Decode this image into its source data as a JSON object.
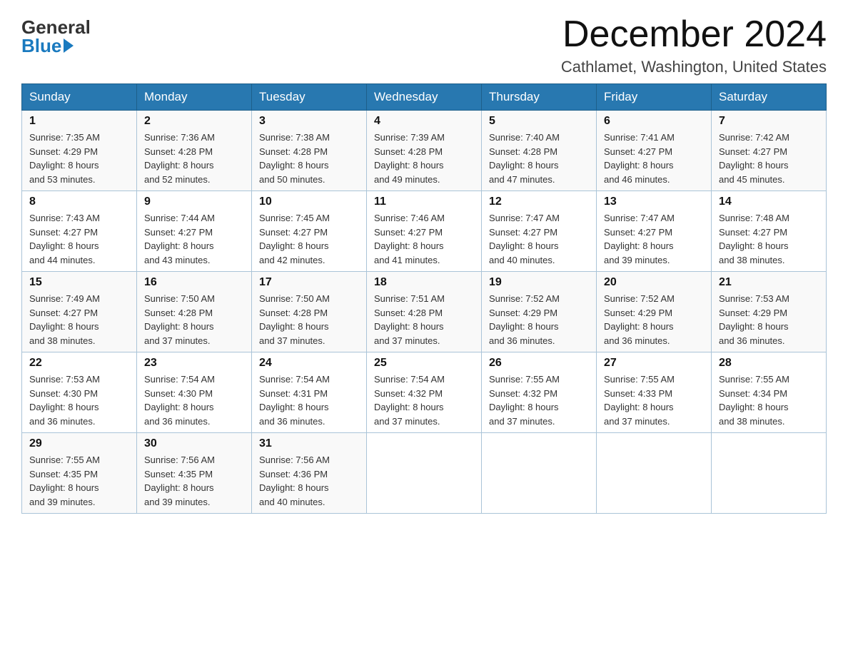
{
  "header": {
    "logo_general": "General",
    "logo_blue": "Blue",
    "month_title": "December 2024",
    "location": "Cathlamet, Washington, United States"
  },
  "days_of_week": [
    "Sunday",
    "Monday",
    "Tuesday",
    "Wednesday",
    "Thursday",
    "Friday",
    "Saturday"
  ],
  "weeks": [
    [
      {
        "day": "1",
        "sunrise": "7:35 AM",
        "sunset": "4:29 PM",
        "daylight": "8 hours and 53 minutes."
      },
      {
        "day": "2",
        "sunrise": "7:36 AM",
        "sunset": "4:28 PM",
        "daylight": "8 hours and 52 minutes."
      },
      {
        "day": "3",
        "sunrise": "7:38 AM",
        "sunset": "4:28 PM",
        "daylight": "8 hours and 50 minutes."
      },
      {
        "day": "4",
        "sunrise": "7:39 AM",
        "sunset": "4:28 PM",
        "daylight": "8 hours and 49 minutes."
      },
      {
        "day": "5",
        "sunrise": "7:40 AM",
        "sunset": "4:28 PM",
        "daylight": "8 hours and 47 minutes."
      },
      {
        "day": "6",
        "sunrise": "7:41 AM",
        "sunset": "4:27 PM",
        "daylight": "8 hours and 46 minutes."
      },
      {
        "day": "7",
        "sunrise": "7:42 AM",
        "sunset": "4:27 PM",
        "daylight": "8 hours and 45 minutes."
      }
    ],
    [
      {
        "day": "8",
        "sunrise": "7:43 AM",
        "sunset": "4:27 PM",
        "daylight": "8 hours and 44 minutes."
      },
      {
        "day": "9",
        "sunrise": "7:44 AM",
        "sunset": "4:27 PM",
        "daylight": "8 hours and 43 minutes."
      },
      {
        "day": "10",
        "sunrise": "7:45 AM",
        "sunset": "4:27 PM",
        "daylight": "8 hours and 42 minutes."
      },
      {
        "day": "11",
        "sunrise": "7:46 AM",
        "sunset": "4:27 PM",
        "daylight": "8 hours and 41 minutes."
      },
      {
        "day": "12",
        "sunrise": "7:47 AM",
        "sunset": "4:27 PM",
        "daylight": "8 hours and 40 minutes."
      },
      {
        "day": "13",
        "sunrise": "7:47 AM",
        "sunset": "4:27 PM",
        "daylight": "8 hours and 39 minutes."
      },
      {
        "day": "14",
        "sunrise": "7:48 AM",
        "sunset": "4:27 PM",
        "daylight": "8 hours and 38 minutes."
      }
    ],
    [
      {
        "day": "15",
        "sunrise": "7:49 AM",
        "sunset": "4:27 PM",
        "daylight": "8 hours and 38 minutes."
      },
      {
        "day": "16",
        "sunrise": "7:50 AM",
        "sunset": "4:28 PM",
        "daylight": "8 hours and 37 minutes."
      },
      {
        "day": "17",
        "sunrise": "7:50 AM",
        "sunset": "4:28 PM",
        "daylight": "8 hours and 37 minutes."
      },
      {
        "day": "18",
        "sunrise": "7:51 AM",
        "sunset": "4:28 PM",
        "daylight": "8 hours and 37 minutes."
      },
      {
        "day": "19",
        "sunrise": "7:52 AM",
        "sunset": "4:29 PM",
        "daylight": "8 hours and 36 minutes."
      },
      {
        "day": "20",
        "sunrise": "7:52 AM",
        "sunset": "4:29 PM",
        "daylight": "8 hours and 36 minutes."
      },
      {
        "day": "21",
        "sunrise": "7:53 AM",
        "sunset": "4:29 PM",
        "daylight": "8 hours and 36 minutes."
      }
    ],
    [
      {
        "day": "22",
        "sunrise": "7:53 AM",
        "sunset": "4:30 PM",
        "daylight": "8 hours and 36 minutes."
      },
      {
        "day": "23",
        "sunrise": "7:54 AM",
        "sunset": "4:30 PM",
        "daylight": "8 hours and 36 minutes."
      },
      {
        "day": "24",
        "sunrise": "7:54 AM",
        "sunset": "4:31 PM",
        "daylight": "8 hours and 36 minutes."
      },
      {
        "day": "25",
        "sunrise": "7:54 AM",
        "sunset": "4:32 PM",
        "daylight": "8 hours and 37 minutes."
      },
      {
        "day": "26",
        "sunrise": "7:55 AM",
        "sunset": "4:32 PM",
        "daylight": "8 hours and 37 minutes."
      },
      {
        "day": "27",
        "sunrise": "7:55 AM",
        "sunset": "4:33 PM",
        "daylight": "8 hours and 37 minutes."
      },
      {
        "day": "28",
        "sunrise": "7:55 AM",
        "sunset": "4:34 PM",
        "daylight": "8 hours and 38 minutes."
      }
    ],
    [
      {
        "day": "29",
        "sunrise": "7:55 AM",
        "sunset": "4:35 PM",
        "daylight": "8 hours and 39 minutes."
      },
      {
        "day": "30",
        "sunrise": "7:56 AM",
        "sunset": "4:35 PM",
        "daylight": "8 hours and 39 minutes."
      },
      {
        "day": "31",
        "sunrise": "7:56 AM",
        "sunset": "4:36 PM",
        "daylight": "8 hours and 40 minutes."
      },
      null,
      null,
      null,
      null
    ]
  ],
  "labels": {
    "sunrise": "Sunrise:",
    "sunset": "Sunset:",
    "daylight": "Daylight:"
  }
}
